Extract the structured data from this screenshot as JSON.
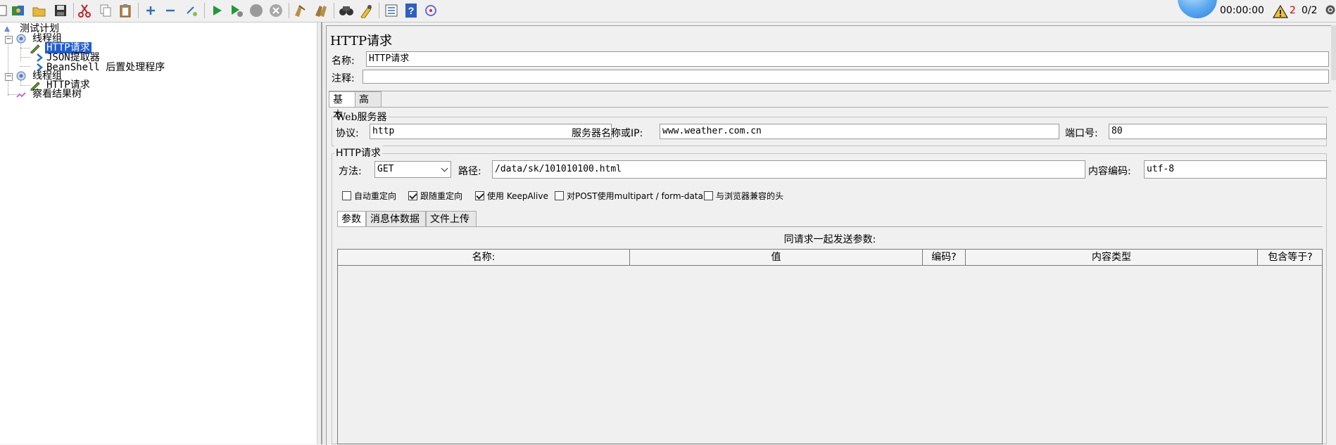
{
  "toolbar": {
    "timer": "00:00:00",
    "error_count": "2",
    "threads": "0/2",
    "icons": [
      "new-icon",
      "templates-icon",
      "open-icon",
      "save-icon",
      "cut-icon",
      "copy-icon",
      "paste-icon",
      "expand-icon",
      "collapse-icon",
      "toggle-icon",
      "start-icon",
      "start-no-pause-icon",
      "stop-icon",
      "shutdown-icon",
      "clear-icon",
      "clear-all-icon",
      "search-icon",
      "reset-search-icon",
      "function-helper-icon",
      "help-icon",
      "remote-icon"
    ]
  },
  "tree": {
    "items": [
      {
        "label": "测试计划",
        "level": 0
      },
      {
        "label": "线程组",
        "level": 1
      },
      {
        "label": "HTTP请求",
        "level": 2,
        "selected": true
      },
      {
        "label": "JSON提取器",
        "level": 3
      },
      {
        "label": "BeanShell 后置处理程序",
        "level": 3
      },
      {
        "label": "线程组",
        "level": 1
      },
      {
        "label": "HTTP请求",
        "level": 2
      },
      {
        "label": "察看结果树",
        "level": 1
      }
    ]
  },
  "panel": {
    "title": "HTTP请求",
    "name_label": "名称:",
    "name_value": "HTTP请求",
    "comment_label": "注释:",
    "comment_value": "",
    "tabs": [
      "基本",
      "高级"
    ],
    "web_server": {
      "title": "Web服务器",
      "protocol_label": "协议:",
      "protocol_value": "http",
      "server_label": "服务器名称或IP:",
      "server_value": "www.weather.com.cn",
      "port_label": "端口号:",
      "port_value": "80"
    },
    "http_request": {
      "title": "HTTP请求",
      "method_label": "方法:",
      "method_value": "GET",
      "path_label": "路径:",
      "path_value": "/data/sk/101010100.html",
      "encoding_label": "内容编码:",
      "encoding_value": "utf-8"
    },
    "checkboxes": [
      {
        "label": "自动重定向",
        "checked": false
      },
      {
        "label": "跟随重定向",
        "checked": true
      },
      {
        "label": "使用 KeepAlive",
        "checked": true
      },
      {
        "label": "对POST使用multipart / form-data",
        "checked": false
      },
      {
        "label": "与浏览器兼容的头",
        "checked": false
      }
    ],
    "sub_tabs": [
      "参数",
      "消息体数据",
      "文件上传"
    ],
    "params_title": "同请求一起发送参数:",
    "table_headers": [
      "名称:",
      "值",
      "编码?",
      "内容类型",
      "包含等于?"
    ]
  },
  "colors": {
    "selection": "#1e5bd6",
    "background": "#f0f0f0",
    "warning": "#dd0000"
  }
}
